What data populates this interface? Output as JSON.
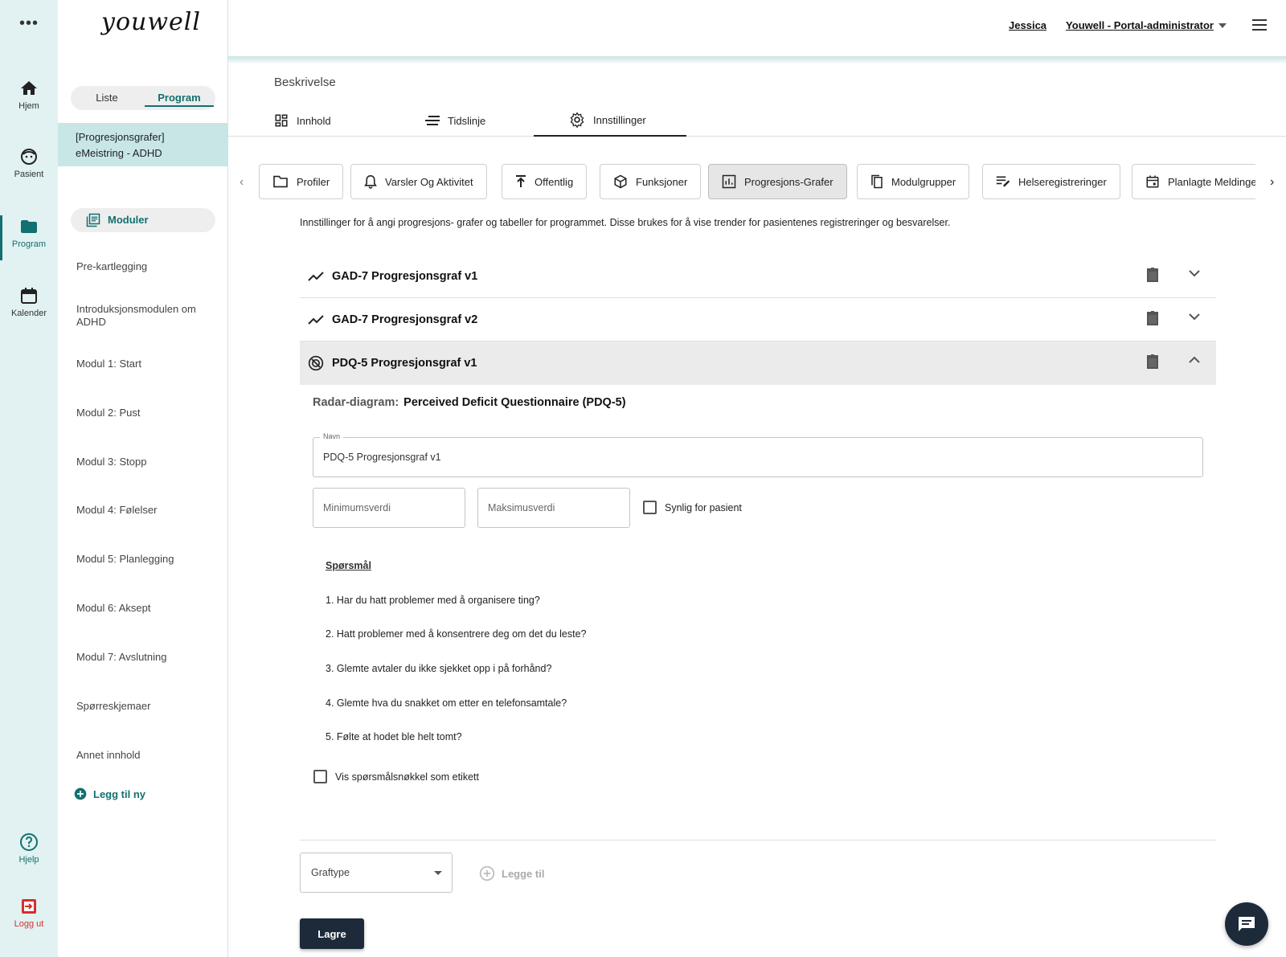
{
  "rail": {
    "more": "•••",
    "items": [
      {
        "label": "Hjem",
        "icon": "home-icon"
      },
      {
        "label": "Pasient",
        "icon": "patient-icon"
      },
      {
        "label": "Program",
        "icon": "folder-icon"
      },
      {
        "label": "Kalender",
        "icon": "calendar-icon"
      },
      {
        "label": "Hjelp",
        "icon": "help-icon"
      },
      {
        "label": "Logg ut",
        "icon": "logout-icon"
      }
    ],
    "accent": "#12706f",
    "logout_color": "#d32f2f"
  },
  "logo": "youwell",
  "sidebar": {
    "toggle": {
      "liste": "Liste",
      "program": "Program"
    },
    "selected_program": [
      "[Progresjonsgrafer]",
      "eMeistring - ADHD"
    ],
    "modules_label": "Moduler",
    "items": [
      "Pre-kartlegging",
      "Introduksjonsmodulen om ADHD",
      "Modul 1: Start",
      "Modul 2: Pust",
      "Modul 3: Stopp",
      "Modul 4: Følelser",
      "Modul 5: Planlegging",
      "Modul 6: Aksept",
      "Modul 7: Avslutning",
      "Spørreskjemaer",
      "Annet innhold"
    ],
    "add_new": "Legg til ny"
  },
  "header": {
    "user": "Jessica",
    "role": "Youwell - Portal-administrator"
  },
  "main": {
    "description": "Beskrivelse",
    "tabs": [
      {
        "label": "Innhold",
        "icon": "grid-icon"
      },
      {
        "label": "Tidslinje",
        "icon": "lines-icon"
      },
      {
        "label": "Innstillinger",
        "icon": "gear-icon"
      }
    ],
    "subtabs": [
      {
        "label": "Profiler",
        "icon": "folder-outline-icon"
      },
      {
        "label": "Varsler Og Aktivitet",
        "icon": "bell-icon"
      },
      {
        "label": "Offentlig",
        "icon": "publish-icon"
      },
      {
        "label": "Funksjoner",
        "icon": "cube-icon"
      },
      {
        "label": "Progresjons-Grafer",
        "icon": "bar-chart-icon"
      },
      {
        "label": "Modulgrupper",
        "icon": "copy-icon"
      },
      {
        "label": "Helseregistreringer",
        "icon": "edit-list-icon"
      },
      {
        "label": "Planlagte Meldinger",
        "icon": "calendar-icon"
      }
    ],
    "intro": "Innstillinger for å angi progresjons- grafer og tabeller for programmet. Disse brukes for å vise trender for pasientenes registreringer og besvarelser.",
    "graphs": [
      {
        "title": "GAD-7 Progresjonsgraf v1",
        "icon": "trend-icon"
      },
      {
        "title": "GAD-7 Progresjonsgraf v2",
        "icon": "trend-icon"
      },
      {
        "title": "PDQ-5 Progresjonsgraf v1",
        "icon": "radar-icon"
      }
    ],
    "detail": {
      "type_label": "Radar-diagram:",
      "type_value": "Perceived Deficit Questionnaire (PDQ-5)",
      "name_label": "Navn",
      "name_value": "PDQ-5 Progresjonsgraf v1",
      "min_placeholder": "Minimumsverdi",
      "max_placeholder": "Maksimusverdi",
      "visible_label": "Synlig for pasient",
      "questions_title": "Spørsmål",
      "questions": [
        "1. Har du hatt problemer med å organisere ting?",
        "2. Hatt problemer med å konsentrere deg om det du leste?",
        "3. Glemte avtaler du ikke sjekket opp i på forhånd?",
        "4. Glemte hva du snakket om etter en telefonsamtale?",
        "5. Følte at hodet ble helt tomt?"
      ],
      "show_key_label": "Vis spørsmålsnøkkel som etikett"
    },
    "graph_type": "Graftype",
    "add": "Legge til",
    "save": "Lagre"
  }
}
